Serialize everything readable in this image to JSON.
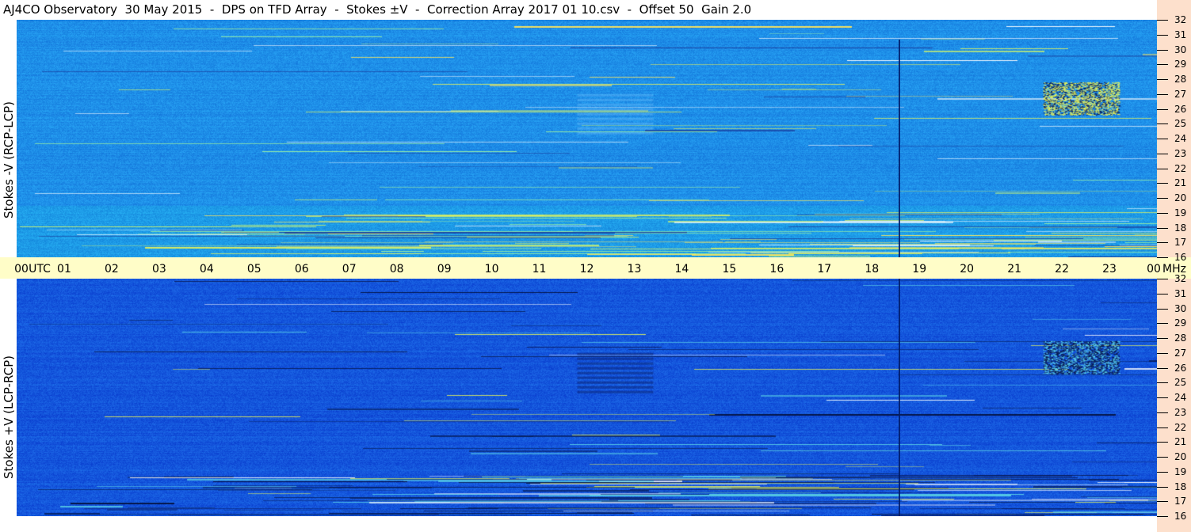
{
  "title": "AJ4CO Observatory  30 May 2015  -  DPS on TFD Array  -  Stokes ±V  -  Correction Array 2017 01 10.csv  -  Offset 50  Gain 2.0",
  "chart_data": [
    {
      "type": "heatmap",
      "ylabel": "Stokes -V (RCP-LCP)",
      "y_range_mhz": [
        16,
        32
      ],
      "x_range_utc": [
        0,
        24
      ],
      "base_color": "#1e8ee8",
      "hot_color": "#e8f060"
    },
    {
      "type": "heatmap",
      "ylabel": "Stokes +V (LCP-RCP)",
      "y_range_mhz": [
        16,
        32
      ],
      "x_range_utc": [
        0,
        24
      ],
      "base_color": "#1456dc",
      "dark_color": "#0a1c5a"
    }
  ],
  "time_axis": {
    "ticks": [
      "00",
      "01",
      "02",
      "03",
      "04",
      "05",
      "06",
      "07",
      "08",
      "09",
      "10",
      "11",
      "12",
      "13",
      "14",
      "15",
      "16",
      "17",
      "18",
      "19",
      "20",
      "21",
      "22",
      "23",
      "00"
    ],
    "unit_start": "UTC",
    "unit_end": "MHz"
  },
  "freq_axis": {
    "ticks": [
      "32",
      "31",
      "30",
      "29",
      "28",
      "27",
      "26",
      "25",
      "24",
      "23",
      "22",
      "21",
      "20",
      "19",
      "18",
      "17",
      "16"
    ]
  },
  "colors": {
    "time_band": "#fffdc8",
    "right_strip": "#fde0cc"
  }
}
